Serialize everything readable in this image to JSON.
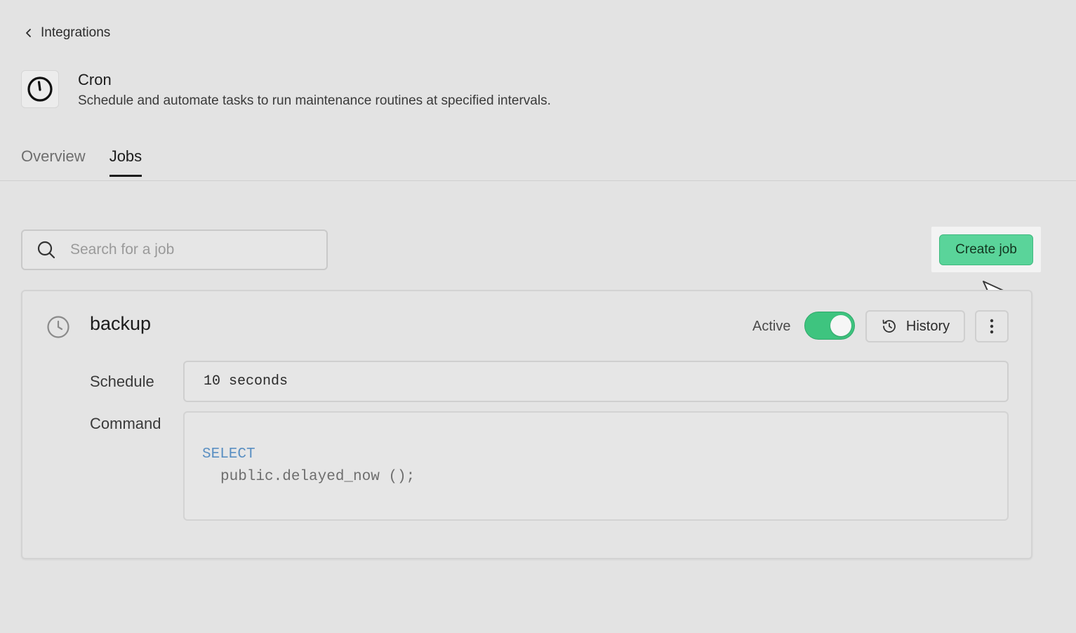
{
  "breadcrumb": {
    "label": "Integrations"
  },
  "app": {
    "title": "Cron",
    "description": "Schedule and automate tasks to run maintenance routines at specified intervals."
  },
  "tabs": [
    {
      "label": "Overview",
      "active": false
    },
    {
      "label": "Jobs",
      "active": true
    }
  ],
  "search": {
    "placeholder": "Search for a job",
    "value": ""
  },
  "actions": {
    "create_label": "Create job"
  },
  "job": {
    "name": "backup",
    "status_label": "Active",
    "enabled": true,
    "history_label": "History",
    "schedule_label": "Schedule",
    "schedule_value": "10 seconds",
    "command_label": "Command",
    "command_keyword": "SELECT",
    "command_body": "public.delayed_now ();"
  },
  "colors": {
    "accent": "#5ad49a",
    "toggle_on": "#3ec47f",
    "sql_keyword": "#5a8fc2",
    "background": "#e3e3e3"
  },
  "icons": {
    "back": "chevron-left-icon",
    "app": "clock-icon",
    "search": "search-icon",
    "job": "clock-icon",
    "history": "history-icon",
    "more": "more-vertical-icon",
    "pointer": "cursor-arrow-icon"
  }
}
